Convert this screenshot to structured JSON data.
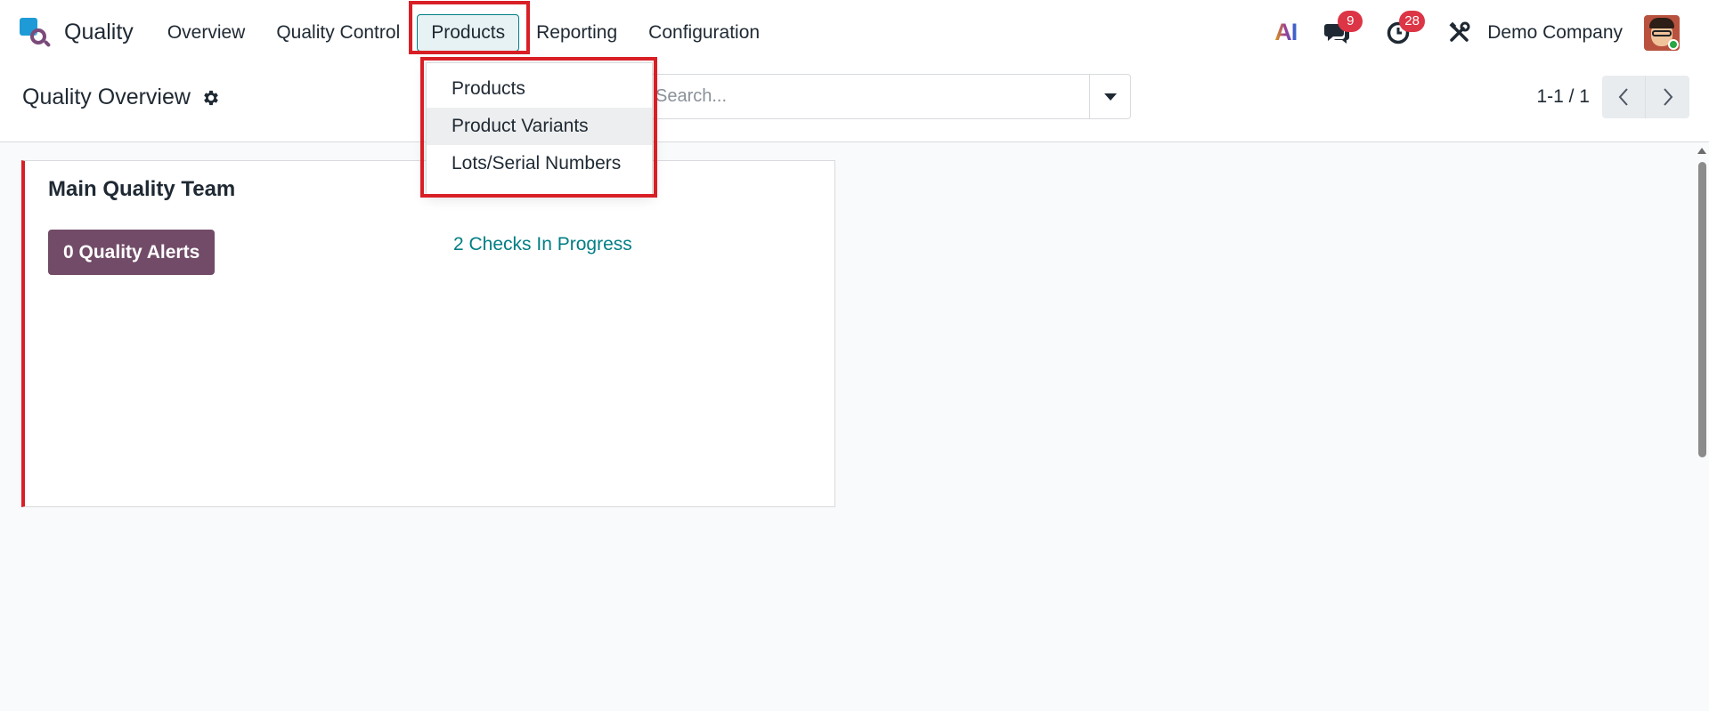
{
  "navbar": {
    "app_name": "Quality",
    "menu": [
      {
        "label": "Overview"
      },
      {
        "label": "Quality Control"
      },
      {
        "label": "Products"
      },
      {
        "label": "Reporting"
      },
      {
        "label": "Configuration"
      }
    ],
    "active_menu": "Products",
    "systray": {
      "ai_label": "AI",
      "messages_count": "9",
      "activities_count": "28",
      "company": "Demo Company"
    }
  },
  "products_dropdown": {
    "items": [
      {
        "label": "Products"
      },
      {
        "label": "Product Variants"
      },
      {
        "label": "Lots/Serial Numbers"
      }
    ],
    "hovered_item": "Product Variants"
  },
  "control_panel": {
    "title": "Quality Overview",
    "search_placeholder": "Search...",
    "pager": "1-1 / 1"
  },
  "kanban": {
    "cards": [
      {
        "team_name": "Main Quality Team",
        "alerts_label": "0 Quality Alerts",
        "checks_label": "2 Checks In Progress"
      }
    ]
  },
  "colors": {
    "brand": "#714b67",
    "accent": "#017e84",
    "highlight": "#d91f26",
    "badge": "#dc3545"
  }
}
